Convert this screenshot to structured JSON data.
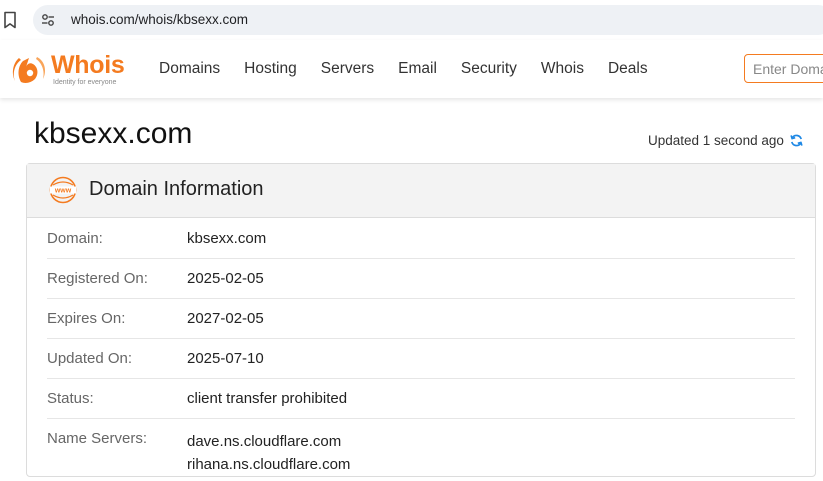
{
  "browser": {
    "url": "whois.com/whois/kbsexx.com",
    "icons": [
      "bookmark-icon",
      "site-info-icon"
    ]
  },
  "header": {
    "logo": {
      "wordmark": "Whois",
      "tagline": "Identity for everyone"
    },
    "nav": [
      "Domains",
      "Hosting",
      "Servers",
      "Email",
      "Security",
      "Whois",
      "Deals"
    ],
    "search_placeholder": "Enter Domain"
  },
  "page": {
    "title": "kbsexx.com",
    "updated": "Updated 1 second ago"
  },
  "domain_info": {
    "heading": "Domain Information",
    "icon": "www-icon",
    "rows": [
      {
        "label": "Domain:",
        "value": "kbsexx.com"
      },
      {
        "label": "Registered On:",
        "value": "2025-02-05"
      },
      {
        "label": "Expires On:",
        "value": "2027-02-05"
      },
      {
        "label": "Updated On:",
        "value": "2025-07-10"
      },
      {
        "label": "Status:",
        "value": "client transfer prohibited"
      },
      {
        "label": "Name Servers:",
        "values": [
          "dave.ns.cloudflare.com",
          "rihana.ns.cloudflare.com"
        ]
      }
    ]
  },
  "colors": {
    "brand": "#f47b20",
    "refresh": "#1e88e5",
    "card_header_bg": "#f3f3f3"
  }
}
